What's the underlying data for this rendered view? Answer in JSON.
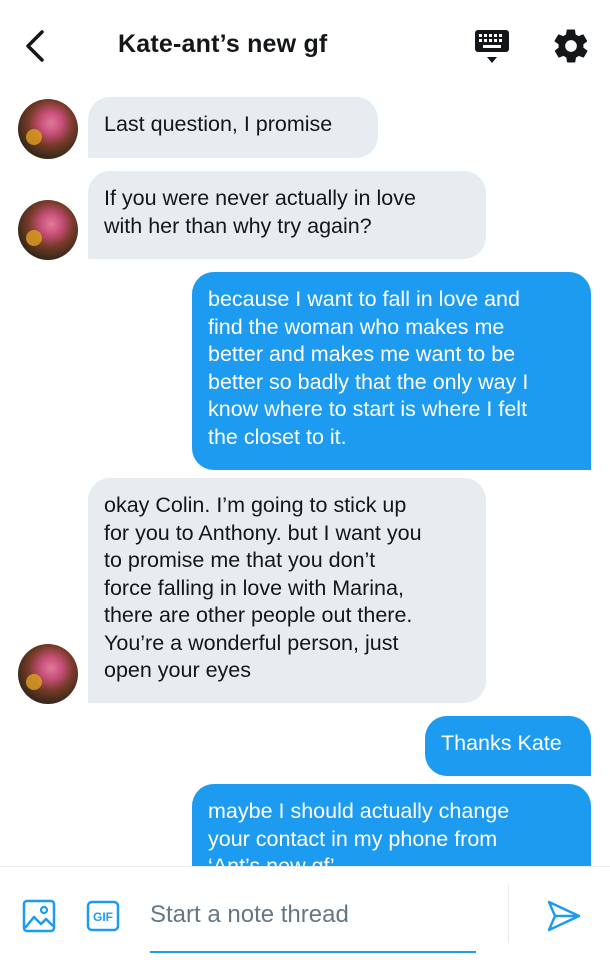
{
  "header": {
    "title": "Kate-ant’s new gf",
    "back_icon": "chevron-left-icon",
    "keyboard_icon": "keyboard-icon",
    "settings_icon": "gear-icon"
  },
  "messages": [
    {
      "direction": "in",
      "text": "Last question, I promise"
    },
    {
      "direction": "in",
      "text": "If you were never actually in love\nwith her than why try again?"
    },
    {
      "direction": "out",
      "text": "because I want to fall in love and\nfind the woman who makes me\nbetter and makes me want to be\nbetter so badly that the only way I\nknow where to start is where I felt\nthe closet to it."
    },
    {
      "direction": "in",
      "text": "okay Colin. I’m going to stick up\nfor you to Anthony. but I want you\nto promise me that you don’t\nforce falling in love with Marina,\nthere are other people out there.\nYou’re a wonderful person, just\nopen your eyes"
    },
    {
      "direction": "out",
      "text": "Thanks Kate"
    },
    {
      "direction": "out",
      "text": "maybe I should actually  change\nyour contact in my phone from\n‘Ant’s new gf’"
    }
  ],
  "composer": {
    "placeholder": "Start a note thread",
    "image_icon": "image-icon",
    "gif_label": "GIF",
    "send_icon": "send-icon"
  },
  "colors": {
    "accent": "#1d9bf0",
    "incoming_bubble": "#e6ecf0",
    "placeholder_text": "#657786"
  }
}
